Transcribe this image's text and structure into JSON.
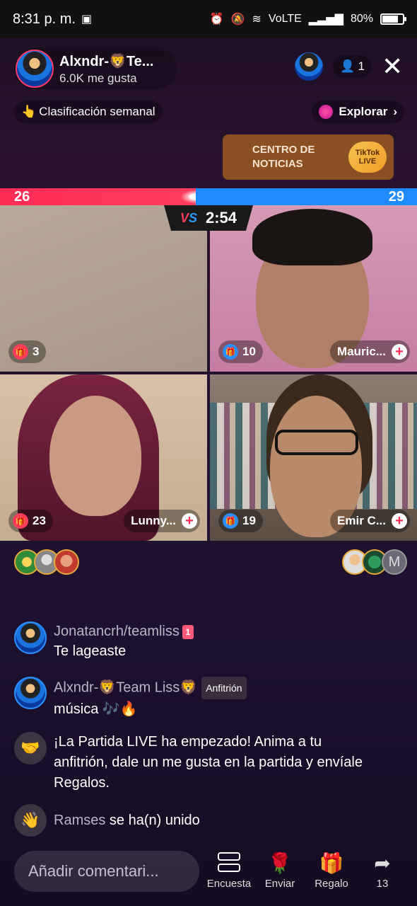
{
  "status": {
    "time": "8:31 p. m.",
    "network": "VoLTE",
    "battery": "80%",
    "battery_level": 0.8
  },
  "host": {
    "name": "Alxndr-🦁Te...",
    "likes": "6.0K me gusta"
  },
  "viewers": "1",
  "ranking": "Clasificación semanal",
  "explore": "Explorar",
  "news": {
    "label": "CENTRO DE NOTICIAS",
    "badge": "TikTok LIVE"
  },
  "battle": {
    "score_red": "26",
    "score_blue": "29",
    "red_share": 0.47,
    "vs": "VS",
    "timer": "2:54"
  },
  "tiles": [
    {
      "gifts": "3",
      "name": ""
    },
    {
      "gifts": "10",
      "name": "Mauric..."
    },
    {
      "gifts": "23",
      "name": "Lunny..."
    },
    {
      "gifts": "19",
      "name": "Emir C..."
    }
  ],
  "supporters_right_initial": "M",
  "chat": [
    {
      "user": "Jonatancrh/teamliss",
      "rank": "1",
      "text": "Te lageaste"
    },
    {
      "user": "Alxndr-🦁Team Liss🦁",
      "badge": "Anfitrión",
      "text": "música 🎶🔥"
    },
    {
      "system": "¡La Partida LIVE ha empezado! Anima a tu anfitrión, dale un me gusta en la partida y envíale Regalos."
    },
    {
      "joined_name": "Ramses",
      "joined_text": "se ha(n) unido"
    }
  ],
  "bottom": {
    "comment_placeholder": "Añadir comentari...",
    "encuesta": "Encuesta",
    "enviar": "Enviar",
    "regalo": "Regalo",
    "share_count": "13"
  }
}
